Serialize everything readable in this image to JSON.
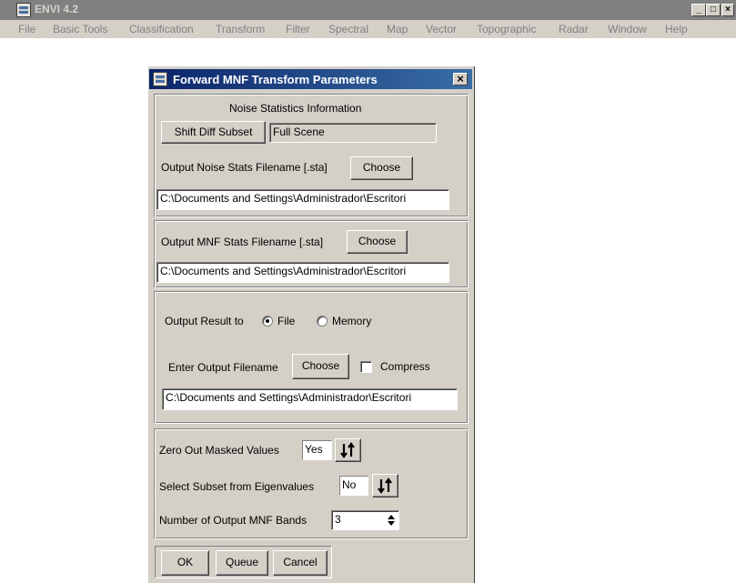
{
  "main_window": {
    "title": "ENVI 4.2",
    "menu": [
      "File",
      "Basic Tools",
      "Classification",
      "Transform",
      "Filter",
      "Spectral",
      "Map",
      "Vector",
      "Topographic",
      "Radar",
      "Window",
      "Help"
    ],
    "minimize_glyph": "_",
    "restore_glyph": "□",
    "close_glyph": "×"
  },
  "dialog": {
    "title": "Forward MNF Transform Parameters",
    "close_glyph": "×",
    "noise_stats": {
      "section_title": "Noise Statistics Information",
      "shift_diff_button": "Shift Diff Subset",
      "subset_value": "Full Scene",
      "output_label": "Output Noise Stats Filename [.sta]",
      "choose_label": "Choose",
      "filename": "C:\\Documents and Settings\\Administrador\\Escritori"
    },
    "mnf_stats": {
      "output_label": "Output MNF Stats Filename [.sta]",
      "choose_label": "Choose",
      "filename": "C:\\Documents and Settings\\Administrador\\Escritori"
    },
    "output_result": {
      "label": "Output Result to",
      "option_file": "File",
      "option_memory": "Memory",
      "selected": "File",
      "enter_filename_label": "Enter Output Filename",
      "choose_label": "Choose",
      "compress_label": "Compress",
      "compress_checked": false,
      "filename": "C:\\Documents and Settings\\Administrador\\Escritori"
    },
    "options": {
      "zero_out_label": "Zero Out Masked Values",
      "zero_out_value": "Yes",
      "subset_eigen_label": "Select Subset from Eigenvalues",
      "subset_eigen_value": "No",
      "num_bands_label": "Number of Output MNF Bands",
      "num_bands_value": "3"
    },
    "buttons": {
      "ok": "OK",
      "queue": "Queue",
      "cancel": "Cancel"
    }
  }
}
